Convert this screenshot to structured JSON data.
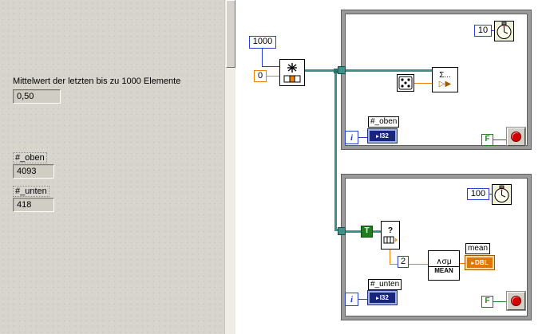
{
  "front_panel": {
    "mean_caption": "Mittelwert der letzten bis zu 1000 Elemente",
    "mean_value": "0,50",
    "oben_label": "#_oben",
    "oben_value": "4093",
    "unten_label": "#_unten",
    "unten_value": "418"
  },
  "diagram": {
    "queue_size_const": "1000",
    "element_const": "0",
    "queue_fn": "obtain-queue-function",
    "loop_top": {
      "wait_ms": "10",
      "sum_line1": "Σ...",
      "sum_line2": "▷▶",
      "oben_label": "#_oben",
      "i32": "I32",
      "iter": "i",
      "stop_const": "F"
    },
    "loop_bottom": {
      "wait_ms": "100",
      "true_const": "T",
      "select_q": "?",
      "two_const": "2",
      "mean_sym": "∧σμ",
      "mean_name": "MEAN",
      "mean_label": "mean",
      "dbl": "DBL",
      "unten_label": "#_unten",
      "i32": "I32",
      "iter": "i",
      "stop_const": "F"
    },
    "tri_glyph": "▸"
  },
  "colors": {
    "panel_gray": "#d8d5ce",
    "wire_teal": "#3f8f8a",
    "wire_orange": "#f08000",
    "wire_blue": "#2b3fd0",
    "wire_green": "#1e7e1e",
    "i32_fill": "#18247e",
    "dbl_fill": "#e07800",
    "stop_red": "#d40000",
    "loop_border": "#9a9a9a"
  }
}
